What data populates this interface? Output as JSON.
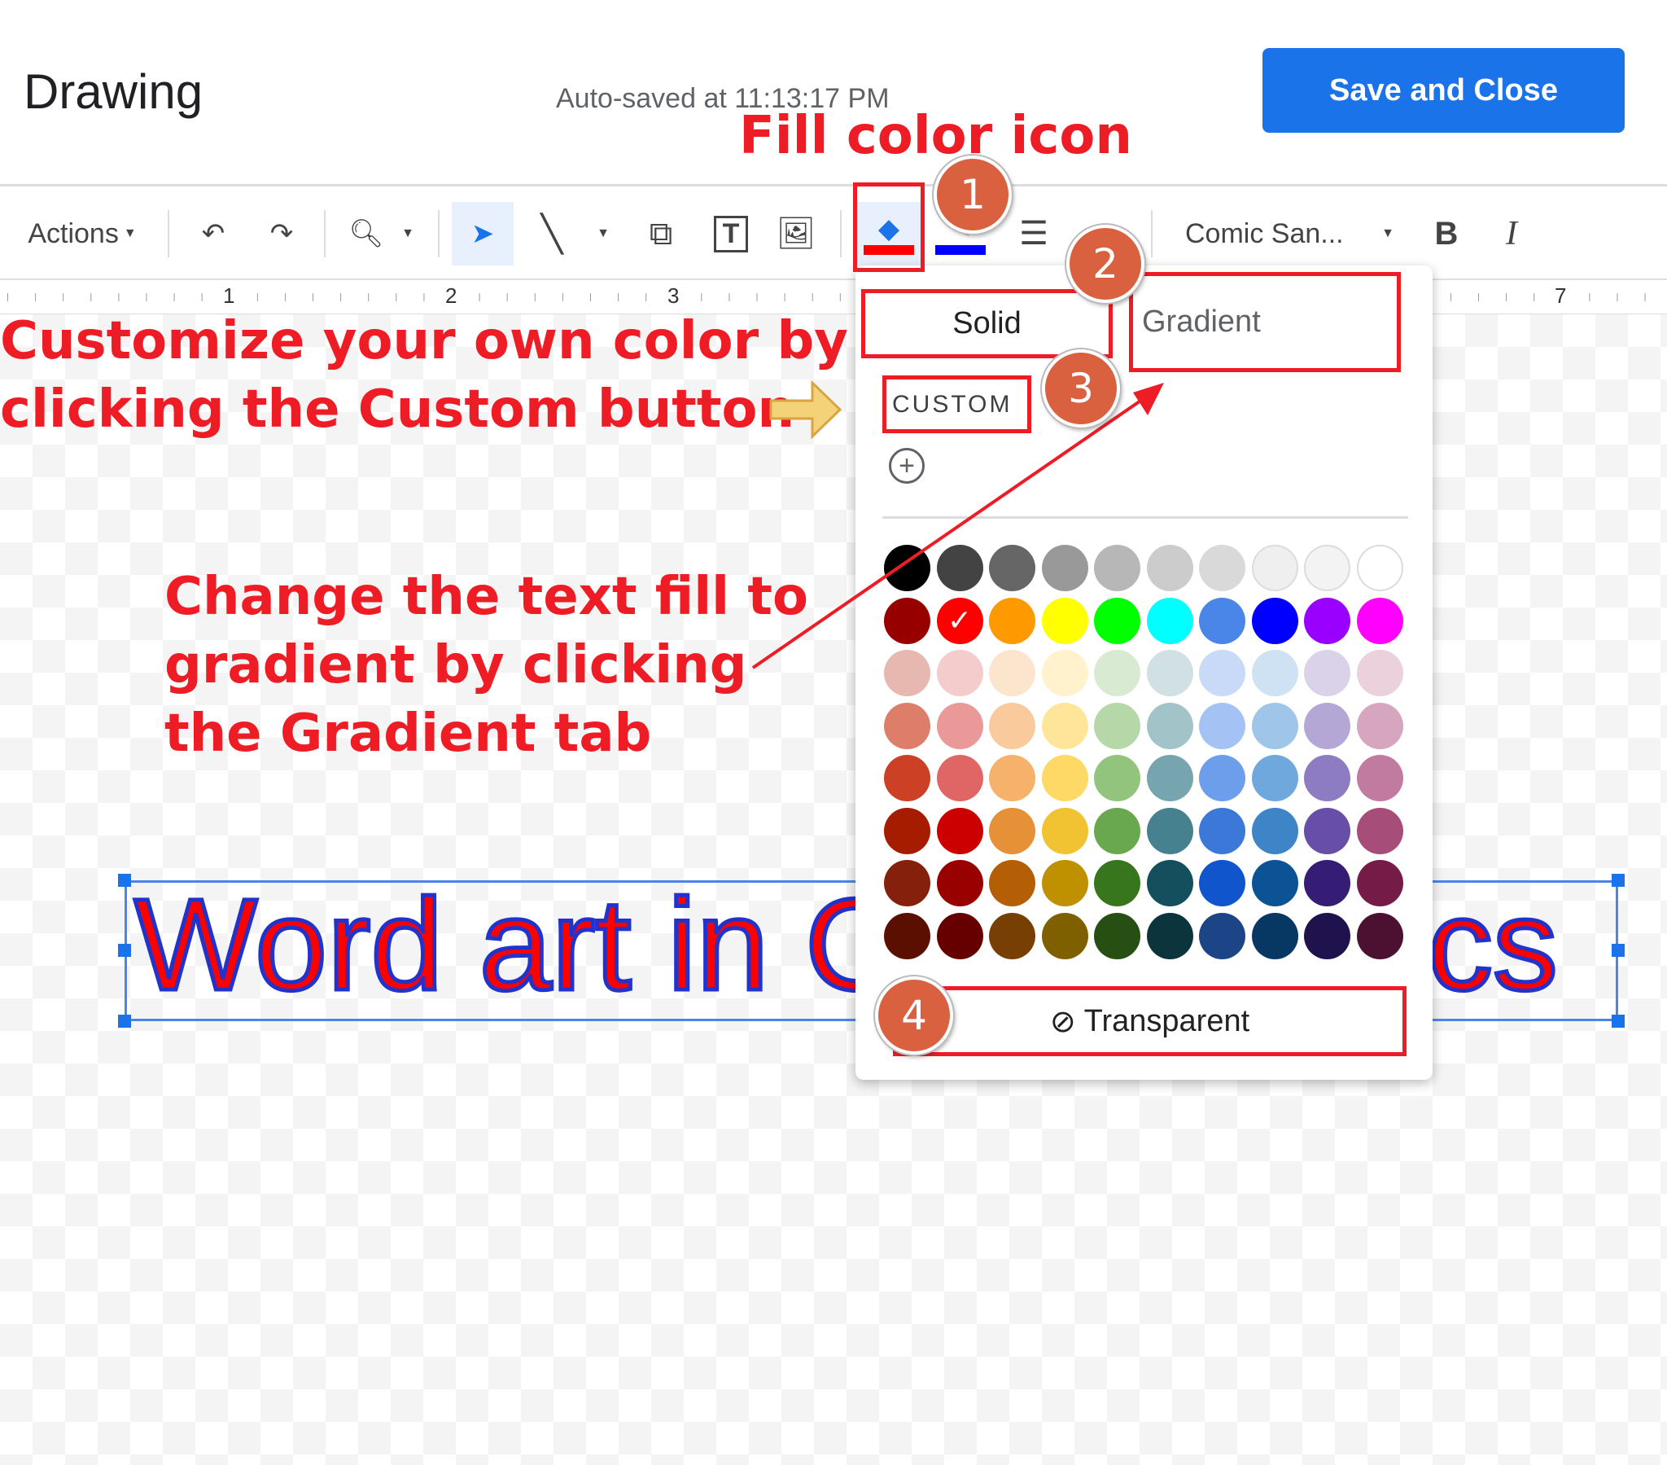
{
  "header": {
    "title": "Drawing",
    "autosave": "Auto-saved at 11:13:17 PM",
    "save_label": "Save and Close"
  },
  "toolbar": {
    "actions": "Actions",
    "font": "Comic San...",
    "bold": "B",
    "italic": "I",
    "fill_color": "#ff0000",
    "border_color": "#0000ff"
  },
  "ruler": {
    "labels": [
      "1",
      "2",
      "3",
      "7"
    ]
  },
  "popup": {
    "tab_solid": "Solid",
    "tab_gradient": "Gradient",
    "custom": "CUSTOM",
    "add": "+",
    "transparent": "Transparent",
    "selected": "#ff0000",
    "palette": [
      [
        "#000000",
        "#434343",
        "#666666",
        "#999999",
        "#b7b7b7",
        "#cccccc",
        "#d9d9d9",
        "#efefef",
        "#f3f3f3",
        "#ffffff"
      ],
      [
        "#980000",
        "#ff0000",
        "#ff9900",
        "#ffff00",
        "#00ff00",
        "#00ffff",
        "#4a86e8",
        "#0000ff",
        "#9900ff",
        "#ff00ff"
      ],
      [
        "#e6b8af",
        "#f4cccc",
        "#fce5cd",
        "#fff2cc",
        "#d9ead3",
        "#d0e0e3",
        "#c9daf8",
        "#cfe2f3",
        "#d9d2e9",
        "#ead1dc"
      ],
      [
        "#dd7e6b",
        "#ea9999",
        "#f9cb9c",
        "#ffe599",
        "#b6d7a8",
        "#a2c4c9",
        "#a4c2f4",
        "#9fc5e8",
        "#b4a7d6",
        "#d5a6bd"
      ],
      [
        "#cc4125",
        "#e06666",
        "#f6b26b",
        "#ffd966",
        "#93c47d",
        "#76a5af",
        "#6d9eeb",
        "#6fa8dc",
        "#8e7cc3",
        "#c27ba0"
      ],
      [
        "#a61c00",
        "#cc0000",
        "#e69138",
        "#f1c232",
        "#6aa84f",
        "#45818e",
        "#3c78d8",
        "#3d85c6",
        "#674ea7",
        "#a64d79"
      ],
      [
        "#85200c",
        "#990000",
        "#b45f06",
        "#bf9000",
        "#38761d",
        "#134f5c",
        "#1155cc",
        "#0b5394",
        "#351c75",
        "#741b47"
      ],
      [
        "#5b0f00",
        "#660000",
        "#783f04",
        "#7f6000",
        "#274e13",
        "#0c343d",
        "#1c4587",
        "#073763",
        "#20124d",
        "#4c1130"
      ]
    ]
  },
  "canvas": {
    "wordart": "Word art in Google Docs"
  },
  "annotations": {
    "fill_icon": "Fill color icon",
    "custom_line1": "Customize your own color by",
    "custom_line2": "clicking the Custom button",
    "gradient_line1": "Change the text fill to",
    "gradient_line2": "gradient by clicking",
    "gradient_line3": "the Gradient tab",
    "badges": [
      "1",
      "2",
      "3",
      "4"
    ]
  }
}
